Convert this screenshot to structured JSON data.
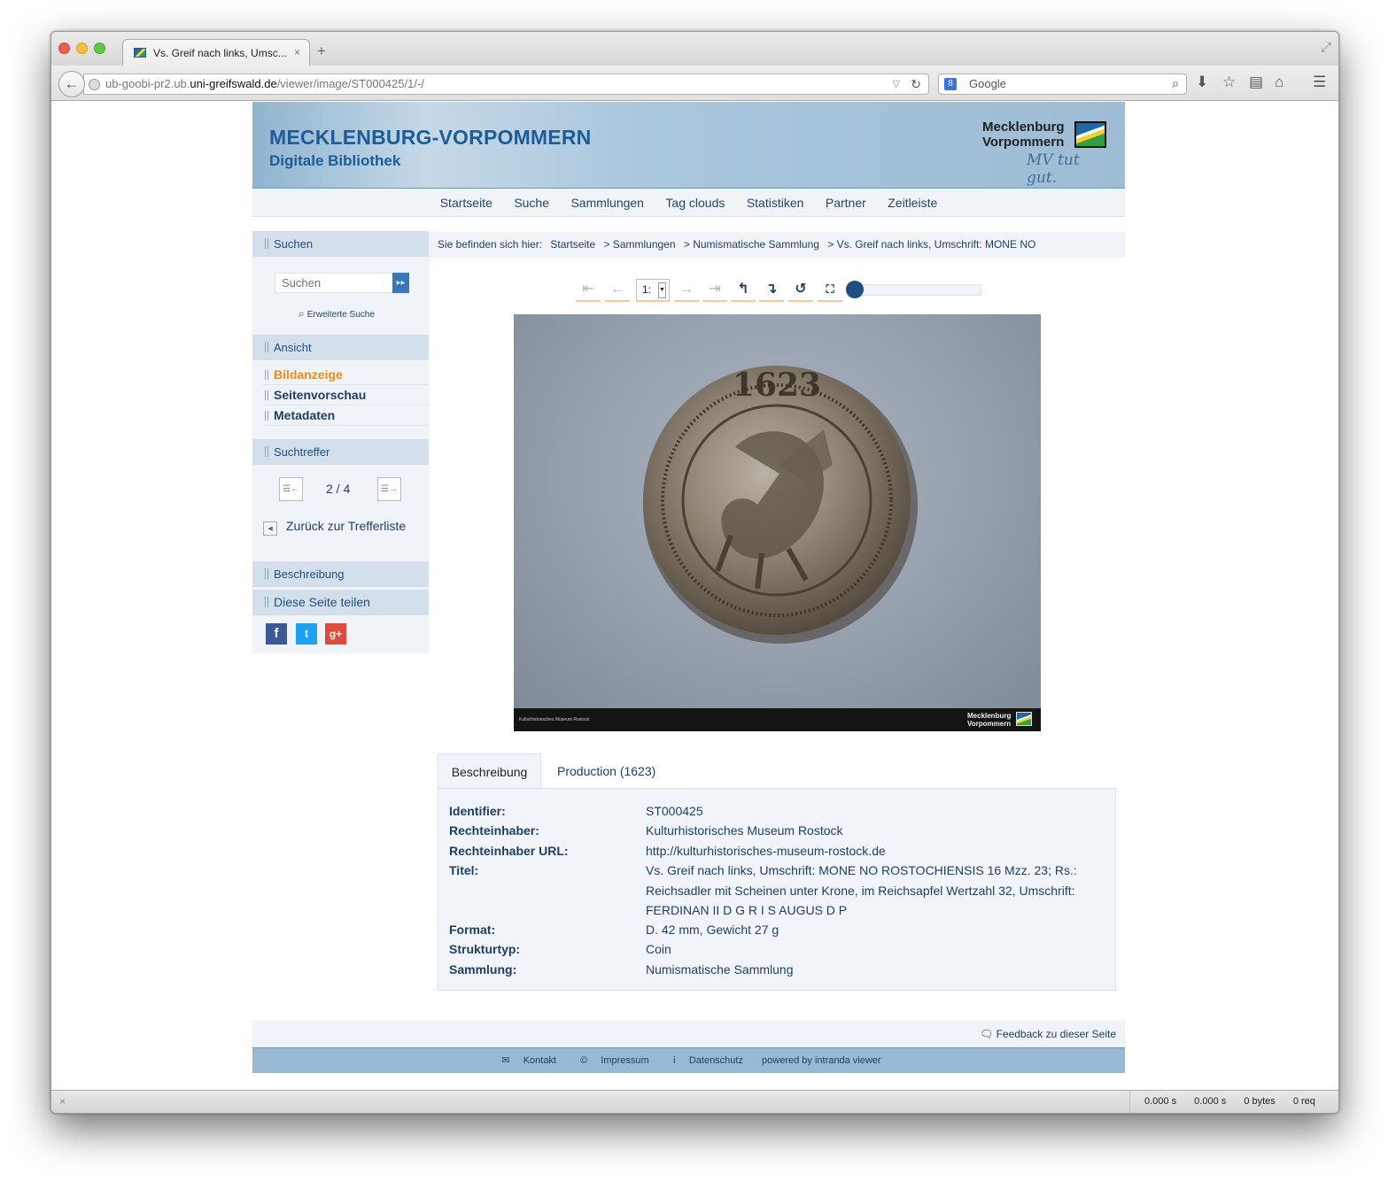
{
  "browser": {
    "tab_title": "Vs. Greif nach links, Umsc...",
    "tab_close": "×",
    "new_tab": "+",
    "url_prefix": "ub-goobi-pr2.ub.",
    "url_domain": "uni-greifswald.de",
    "url_path": "/viewer/image/ST000425/1/-/",
    "search_engine": "Google",
    "status": {
      "time1": "0.000 s",
      "time2": "0.000 s",
      "bytes": "0 bytes",
      "req": "0 req"
    }
  },
  "header": {
    "title": "MECKLENBURG-VORPOMMERN",
    "subtitle": "Digitale Bibliothek",
    "logo_line1": "Mecklenburg",
    "logo_line2": "Vorpommern",
    "logo_slogan": "MV tut gut."
  },
  "nav": [
    "Startseite",
    "Suche",
    "Sammlungen",
    "Tag clouds",
    "Statistiken",
    "Partner",
    "Zeitleiste"
  ],
  "sidebar": {
    "search_heading": "Suchen",
    "search_placeholder": "Suchen",
    "advanced_search": "Erweiterte Suche",
    "view_heading": "Ansicht",
    "view_items": [
      "Bildanzeige",
      "Seitenvorschau",
      "Metadaten"
    ],
    "hits_heading": "Suchtreffer",
    "hit_count": "2 / 4",
    "back_to_list": "Zurück zur Trefferliste",
    "description_heading": "Beschreibung",
    "share_heading": "Diese Seite teilen",
    "social": [
      "f",
      "t",
      "g+"
    ]
  },
  "breadcrumb": {
    "prefix": "Sie befinden sich hier:",
    "items": [
      "Startseite",
      "> Sammlungen",
      "> Numismatische Sammlung",
      "> Vs. Greif nach links, Umschrift: MONE NO"
    ]
  },
  "viewer": {
    "page_select": "1:",
    "image_caption": "Kulturhistorisches Museum Rostock",
    "image_logo_line1": "Mecklenburg",
    "image_logo_line2": "Vorpommern",
    "zoom_level": 0
  },
  "metadata_tabs": [
    "Beschreibung",
    "Production (1623)"
  ],
  "metadata": [
    {
      "label": "Identifier:",
      "value": "ST000425"
    },
    {
      "label": "Rechteinhaber:",
      "value": "Kulturhistorisches Museum Rostock"
    },
    {
      "label": "Rechteinhaber URL:",
      "value": "http://kulturhistorisches-museum-rostock.de"
    },
    {
      "label": "Titel:",
      "value": "Vs. Greif nach links, Umschrift: MONE NO ROSTOCHIENSIS 16 Mzz. 23; Rs.: Reichsadler mit Scheinen unter Krone, im Reichsapfel Wertzahl 32, Umschrift: FERDINAN II D G R I S AUGUS D P"
    },
    {
      "label": "Format:",
      "value": "D. 42 mm, Gewicht 27 g"
    },
    {
      "label": "Strukturtyp:",
      "value": "Coin"
    },
    {
      "label": "Sammlung:",
      "value": "Numismatische Sammlung"
    }
  ],
  "feedback": "Feedback zu dieser Seite",
  "footer": [
    "Kontakt",
    "Impressum",
    "Datenschutz",
    "powered by intranda viewer"
  ],
  "colors": {
    "accent": "#1f4f80",
    "active": "#f08c12",
    "banner": "#a9c6dc"
  }
}
